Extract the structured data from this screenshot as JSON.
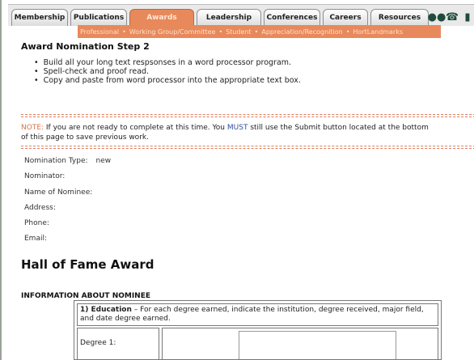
{
  "tabs": [
    {
      "label": "Membership"
    },
    {
      "label": "Publications"
    },
    {
      "label": "Awards"
    },
    {
      "label": "Leadership"
    },
    {
      "label": "Conferences"
    },
    {
      "label": "Careers"
    },
    {
      "label": "Resources"
    }
  ],
  "subnav": [
    {
      "label": "Professional"
    },
    {
      "label": "Working Group/Committee"
    },
    {
      "label": "Student"
    },
    {
      "label": "Appreciation/Recognition"
    },
    {
      "label": "HortLandmarks"
    }
  ],
  "subnav_separator": "•",
  "page": {
    "step_title": "Award Nomination Step 2",
    "bullets": [
      "Build all your long text respsonses in a word processor program.",
      "Spell-check and proof read.",
      "Copy and paste from word processor into the appropriate text box."
    ],
    "note": {
      "label": "NOTE:",
      "part1": " If you are not ready to complete at this time. You ",
      "must": "MUST",
      "part2": " still use the Submit button located at the bottom",
      "line2": "of this page to save previous work."
    },
    "fields": [
      {
        "label": "Nomination Type:",
        "value": "new"
      },
      {
        "label": "Nominator:",
        "value": ""
      },
      {
        "label": "Name of Nominee:",
        "value": ""
      },
      {
        "label": "Address:",
        "value": ""
      },
      {
        "label": "Phone:",
        "value": ""
      },
      {
        "label": "Email:",
        "value": ""
      }
    ],
    "award_title": "Hall of Fame Award",
    "info_heading": "INFORMATION ABOUT NOMINEE",
    "education": {
      "number_label": "1) Education",
      "description": " – For each degree earned, indicate the institution, degree received, major field, and date degree earned.",
      "degree_label": "Degree 1:"
    }
  },
  "colors": {
    "accent": "#e8895b",
    "note": "#d8734a",
    "must": "#2e4fa0"
  }
}
